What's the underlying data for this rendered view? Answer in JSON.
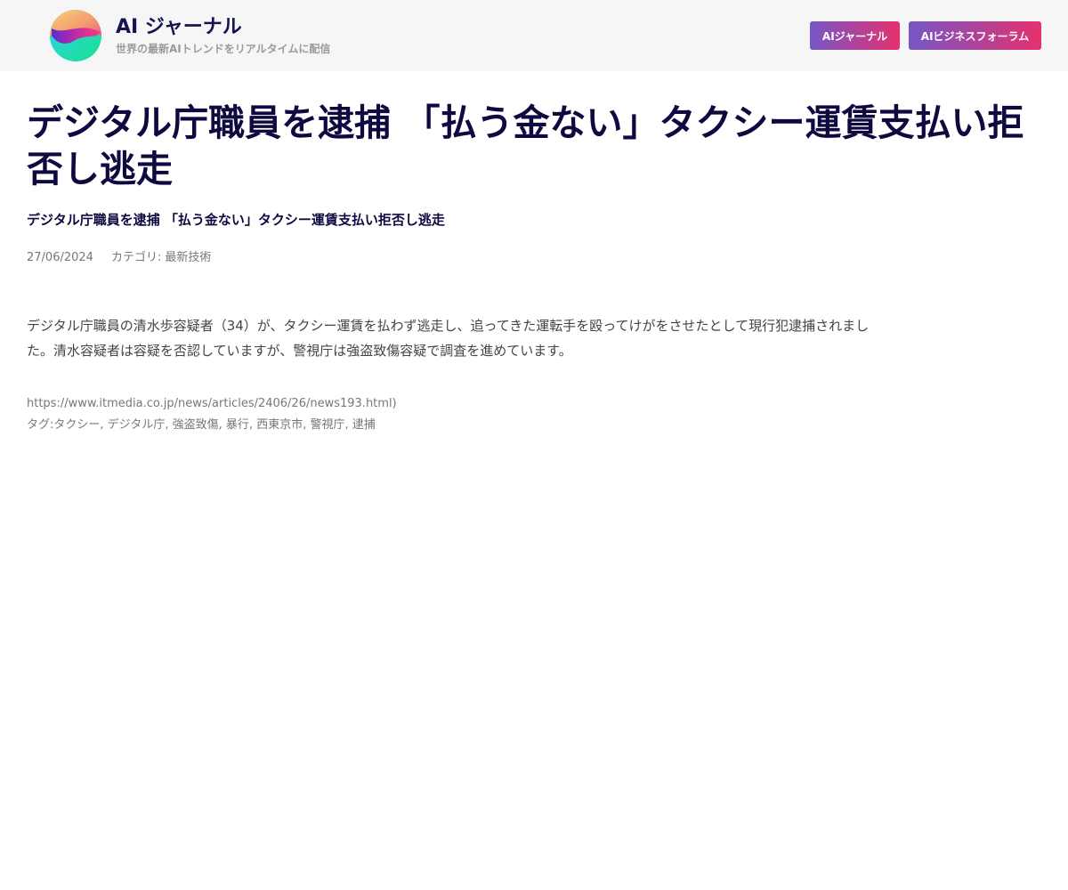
{
  "header": {
    "brand_title": "AI ジャーナル",
    "brand_tagline": "世界の最新AIトレンドをリアルタイムに配信",
    "logo_icon": "gradient-sphere-logo",
    "nav": [
      {
        "label": "AIジャーナル"
      },
      {
        "label": "AIビジネスフォーラム"
      }
    ],
    "nav_gradient": [
      "#7656c6",
      "#e5316e"
    ]
  },
  "article": {
    "title": "デジタル庁職員を逮捕 「払う金ない」タクシー運賃支払い拒否し逃走",
    "subtitle": "デジタル庁職員を逮捕 「払う金ない」タクシー運賃支払い拒否し逃走",
    "date": "27/06/2024",
    "category_prefix": "カテゴリ:",
    "category": "最新技術",
    "body": "デジタル庁職員の清水歩容疑者（34）が、タクシー運賃を払わず逃走し、追ってきた運転手を殴ってけがをさせたとして現行犯逮捕されました。清水容疑者は容疑を否認していますが、警視庁は強盗致傷容疑で調査を進めています。",
    "source": "https://www.itmedia.co.jp/news/articles/2406/26/news193.html)",
    "tags_prefix": "タグ: ",
    "tags": "タクシー, デジタル庁, 強盗致傷, 暴行, 西東京市, 警視庁, 逮捕"
  },
  "colors": {
    "title": "#0e0a3f",
    "header_bg": "#f6f6f6",
    "meta": "#777777"
  }
}
